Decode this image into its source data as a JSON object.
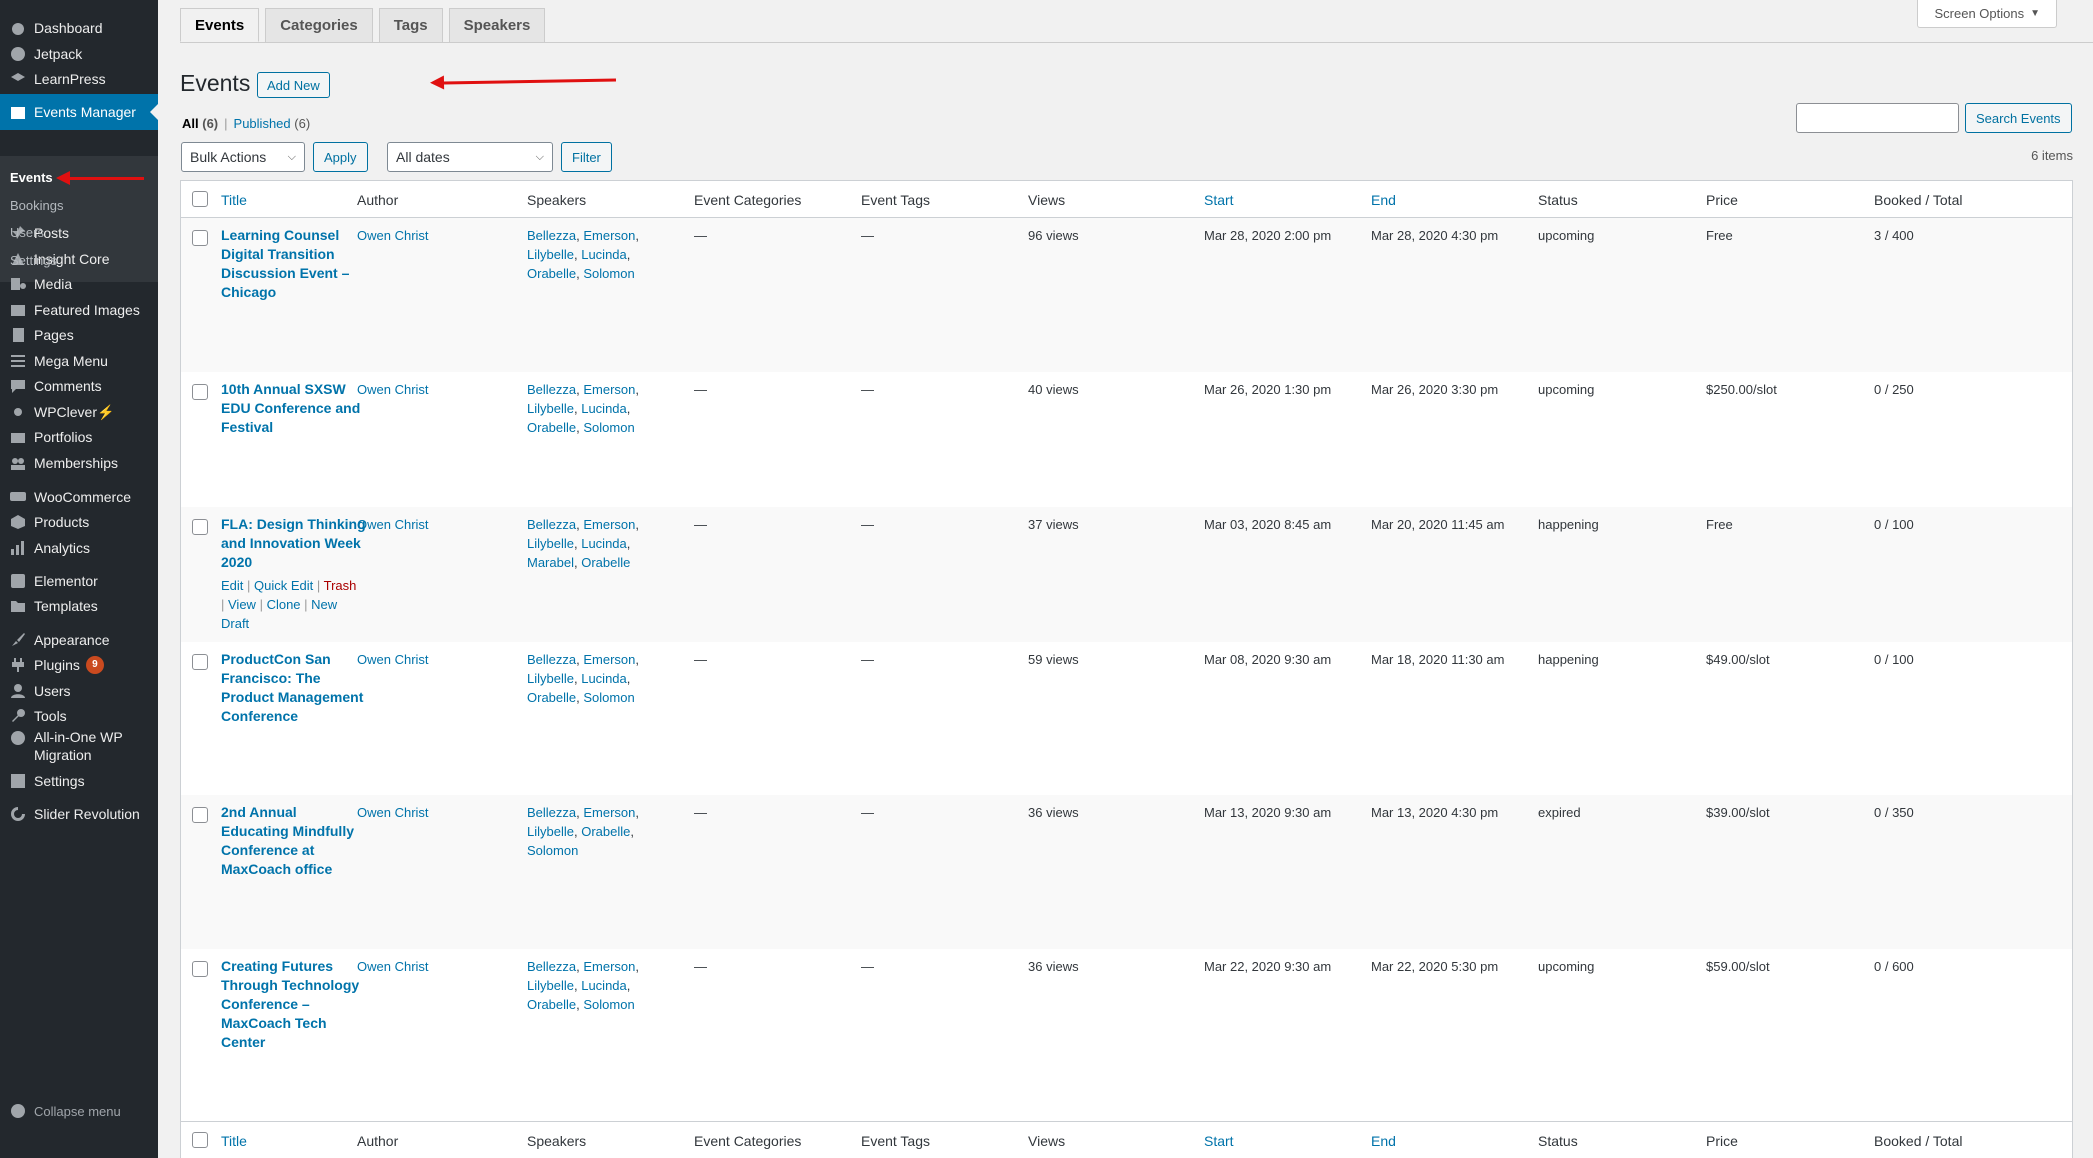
{
  "sidebar": {
    "items": [
      {
        "label": "Dashboard",
        "icon": "dashboard-icon"
      },
      {
        "label": "Jetpack",
        "icon": "jetpack-icon"
      },
      {
        "label": "LearnPress",
        "icon": "learnpress-icon"
      },
      {
        "label": "Events Manager",
        "icon": "calendar-icon"
      },
      {
        "label": "Posts",
        "icon": "pin-icon"
      },
      {
        "label": "Insight Core",
        "icon": "insight-icon"
      },
      {
        "label": "Media",
        "icon": "media-icon"
      },
      {
        "label": "Featured Images",
        "icon": "images-icon"
      },
      {
        "label": "Pages",
        "icon": "pages-icon"
      },
      {
        "label": "Mega Menu",
        "icon": "menu-icon"
      },
      {
        "label": "Comments",
        "icon": "comments-icon"
      },
      {
        "label": "WPClever",
        "icon": "wpclever-icon",
        "suffix": "⚡"
      },
      {
        "label": "Portfolios",
        "icon": "portfolio-icon"
      },
      {
        "label": "Memberships",
        "icon": "groups-icon"
      },
      {
        "label": "WooCommerce",
        "icon": "woocommerce-icon"
      },
      {
        "label": "Products",
        "icon": "products-icon"
      },
      {
        "label": "Analytics",
        "icon": "analytics-icon"
      },
      {
        "label": "Elementor",
        "icon": "elementor-icon"
      },
      {
        "label": "Templates",
        "icon": "folder-icon"
      },
      {
        "label": "Appearance",
        "icon": "brush-icon"
      },
      {
        "label": "Plugins",
        "icon": "plugin-icon",
        "badge": "9"
      },
      {
        "label": "Users",
        "icon": "user-icon"
      },
      {
        "label": "Tools",
        "icon": "wrench-icon"
      },
      {
        "label": "All-in-One WP",
        "label2": "Migration",
        "icon": "migration-icon"
      },
      {
        "label": "Settings",
        "icon": "settings-icon"
      },
      {
        "label": "Slider Revolution",
        "icon": "refresh-icon"
      }
    ],
    "submenu": [
      "Events",
      "Bookings",
      "Users",
      "Settings"
    ],
    "collapse_label": "Collapse menu"
  },
  "tabs": [
    "Events",
    "Categories",
    "Tags",
    "Speakers"
  ],
  "screen_options": "Screen Options",
  "page_title": "Events",
  "add_new": "Add New",
  "views": {
    "all": "All",
    "all_count": "(6)",
    "published": "Published",
    "published_count": "(6)"
  },
  "search_button": "Search Events",
  "bulk_actions": "Bulk Actions",
  "apply": "Apply",
  "all_dates": "All dates",
  "filter": "Filter",
  "items_count": "6 items",
  "columns": [
    "Title",
    "Author",
    "Speakers",
    "Event Categories",
    "Event Tags",
    "Views",
    "Start",
    "End",
    "Status",
    "Price",
    "Booked / Total"
  ],
  "rows": [
    {
      "title": [
        "Learning Counsel",
        "Digital Transition",
        "Discussion Event –",
        "Chicago"
      ],
      "author": "Owen Christ",
      "speakers": [
        [
          "Bellezza",
          "Emerson"
        ],
        [
          "Lilybelle",
          "Lucinda"
        ],
        [
          "Orabelle",
          "Solomon"
        ]
      ],
      "cats": "—",
      "tags": "—",
      "views": "96 views",
      "start": "Mar 28, 2020 2:00 pm",
      "end": "Mar 28, 2020 4:30 pm",
      "status": "upcoming",
      "price": "Free",
      "booked": "3 / 400"
    },
    {
      "title": [
        "10th Annual SXSW",
        "EDU Conference and",
        "Festival"
      ],
      "author": "Owen Christ",
      "speakers": [
        [
          "Bellezza",
          "Emerson"
        ],
        [
          "Lilybelle",
          "Lucinda"
        ],
        [
          "Orabelle",
          "Solomon"
        ]
      ],
      "cats": "—",
      "tags": "—",
      "views": "40 views",
      "start": "Mar 26, 2020 1:30 pm",
      "end": "Mar 26, 2020 3:30 pm",
      "status": "upcoming",
      "price": "$250.00/slot",
      "booked": "0 / 250"
    },
    {
      "title": [
        "FLA: Design Thinking",
        "and Innovation Week",
        "2020"
      ],
      "author": "Owen Christ",
      "speakers": [
        [
          "Bellezza",
          "Emerson"
        ],
        [
          "Lilybelle",
          "Lucinda"
        ],
        [
          "Marabel",
          "Orabelle"
        ]
      ],
      "cats": "—",
      "tags": "—",
      "views": "37 views",
      "start": "Mar 03, 2020 8:45 am",
      "end": "Mar 20, 2020 11:45 am",
      "status": "happening",
      "price": "Free",
      "booked": "0 / 100",
      "actions": {
        "edit": "Edit",
        "quick_edit": "Quick Edit",
        "trash": "Trash",
        "view": "View",
        "clone": "Clone",
        "new": "New",
        "draft": "Draft"
      }
    },
    {
      "title": [
        "ProductCon San",
        "Francisco: The",
        "Product Management",
        "Conference"
      ],
      "author": "Owen Christ",
      "speakers": [
        [
          "Bellezza",
          "Emerson"
        ],
        [
          "Lilybelle",
          "Lucinda"
        ],
        [
          "Orabelle",
          "Solomon"
        ]
      ],
      "cats": "—",
      "tags": "—",
      "views": "59 views",
      "start": "Mar 08, 2020 9:30 am",
      "end": "Mar 18, 2020 11:30 am",
      "status": "happening",
      "price": "$49.00/slot",
      "booked": "0 / 100"
    },
    {
      "title": [
        "2nd Annual",
        "Educating Mindfully",
        "Conference at",
        "MaxCoach office"
      ],
      "author": "Owen Christ",
      "speakers": [
        [
          "Bellezza",
          "Emerson"
        ],
        [
          "Lilybelle",
          "Orabelle"
        ],
        [
          "Solomon"
        ]
      ],
      "cats": "—",
      "tags": "—",
      "views": "36 views",
      "start": "Mar 13, 2020 9:30 am",
      "end": "Mar 13, 2020 4:30 pm",
      "status": "expired",
      "price": "$39.00/slot",
      "booked": "0 / 350"
    },
    {
      "title": [
        "Creating Futures",
        "Through Technology",
        "Conference –",
        "MaxCoach Tech",
        "Center"
      ],
      "author": "Owen Christ",
      "speakers": [
        [
          "Bellezza",
          "Emerson"
        ],
        [
          "Lilybelle",
          "Lucinda"
        ],
        [
          "Orabelle",
          "Solomon"
        ]
      ],
      "cats": "—",
      "tags": "—",
      "views": "36 views",
      "start": "Mar 22, 2020 9:30 am",
      "end": "Mar 22, 2020 5:30 pm",
      "status": "upcoming",
      "price": "$59.00/slot",
      "booked": "0 / 600"
    }
  ]
}
